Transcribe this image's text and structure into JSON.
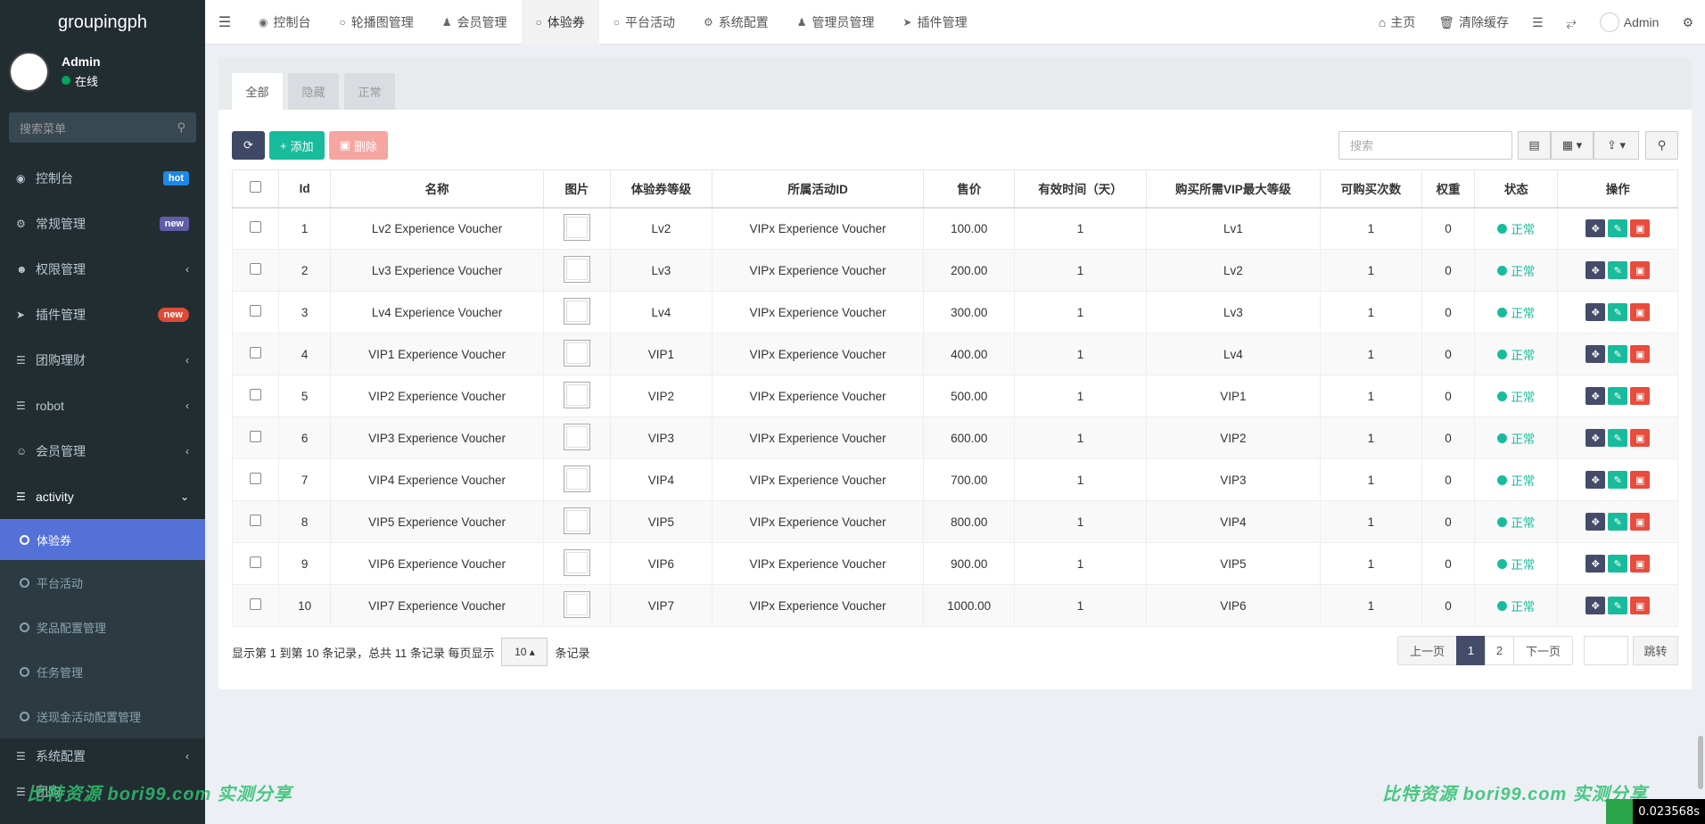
{
  "app": {
    "logo": "groupingph"
  },
  "user": {
    "name": "Admin",
    "status": "在线"
  },
  "sidebar": {
    "search_placeholder": "搜索菜单",
    "items": [
      {
        "label": "控制台",
        "icon": "dashboard-icon",
        "badge": "hot"
      },
      {
        "label": "常规管理",
        "icon": "cogs-icon",
        "badge": "new"
      },
      {
        "label": "权限管理",
        "icon": "group-icon"
      },
      {
        "label": "插件管理",
        "icon": "rocket-icon",
        "badge": "new"
      },
      {
        "label": "团购理财",
        "icon": "list-icon"
      },
      {
        "label": "robot",
        "icon": "list-icon"
      },
      {
        "label": "会员管理",
        "icon": "user-circle-icon"
      },
      {
        "label": "activity",
        "icon": "list-icon"
      }
    ],
    "subitems": [
      {
        "label": "体验券"
      },
      {
        "label": "平台活动"
      },
      {
        "label": "奖品配置管理"
      },
      {
        "label": "任务管理"
      },
      {
        "label": "送现金活动配置管理"
      }
    ],
    "bottom_items": [
      {
        "label": "系统配置"
      },
      {
        "label": "团购"
      }
    ]
  },
  "topnav": {
    "tabs": [
      {
        "label": "控制台",
        "icon": "dashboard-icon"
      },
      {
        "label": "轮播图管理",
        "icon": "circle-icon"
      },
      {
        "label": "会员管理",
        "icon": "user-icon"
      },
      {
        "label": "体验券",
        "icon": "circle-icon"
      },
      {
        "label": "平台活动",
        "icon": "circle-icon"
      },
      {
        "label": "系统配置",
        "icon": "cog-icon"
      },
      {
        "label": "管理员管理",
        "icon": "user-icon"
      },
      {
        "label": "插件管理",
        "icon": "rocket-icon"
      }
    ],
    "right": {
      "home": "主页",
      "clear_cache": "清除缓存",
      "admin": "Admin"
    }
  },
  "filter_tabs": [
    "全部",
    "隐藏",
    "正常"
  ],
  "toolbar": {
    "add": "添加",
    "delete": "删除",
    "search_placeholder": "搜索"
  },
  "table": {
    "headers": [
      "Id",
      "名称",
      "图片",
      "体验券等级",
      "所属活动ID",
      "售价",
      "有效时间（天）",
      "购买所需VIP最大等级",
      "可购买次数",
      "权重",
      "状态",
      "操作"
    ],
    "rows": [
      {
        "id": "1",
        "name": "Lv2 Experience Voucher",
        "level": "Lv2",
        "activity": "VIPx Experience Voucher",
        "price": "100.00",
        "days": "1",
        "vip": "Lv1",
        "times": "1",
        "weight": "0",
        "status": "正常"
      },
      {
        "id": "2",
        "name": "Lv3 Experience Voucher",
        "level": "Lv3",
        "activity": "VIPx Experience Voucher",
        "price": "200.00",
        "days": "1",
        "vip": "Lv2",
        "times": "1",
        "weight": "0",
        "status": "正常"
      },
      {
        "id": "3",
        "name": "Lv4 Experience Voucher",
        "level": "Lv4",
        "activity": "VIPx Experience Voucher",
        "price": "300.00",
        "days": "1",
        "vip": "Lv3",
        "times": "1",
        "weight": "0",
        "status": "正常"
      },
      {
        "id": "4",
        "name": "VIP1 Experience Voucher",
        "level": "VIP1",
        "activity": "VIPx Experience Voucher",
        "price": "400.00",
        "days": "1",
        "vip": "Lv4",
        "times": "1",
        "weight": "0",
        "status": "正常"
      },
      {
        "id": "5",
        "name": "VIP2 Experience Voucher",
        "level": "VIP2",
        "activity": "VIPx Experience Voucher",
        "price": "500.00",
        "days": "1",
        "vip": "VIP1",
        "times": "1",
        "weight": "0",
        "status": "正常"
      },
      {
        "id": "6",
        "name": "VIP3 Experience Voucher",
        "level": "VIP3",
        "activity": "VIPx Experience Voucher",
        "price": "600.00",
        "days": "1",
        "vip": "VIP2",
        "times": "1",
        "weight": "0",
        "status": "正常"
      },
      {
        "id": "7",
        "name": "VIP4 Experience Voucher",
        "level": "VIP4",
        "activity": "VIPx Experience Voucher",
        "price": "700.00",
        "days": "1",
        "vip": "VIP3",
        "times": "1",
        "weight": "0",
        "status": "正常"
      },
      {
        "id": "8",
        "name": "VIP5 Experience Voucher",
        "level": "VIP5",
        "activity": "VIPx Experience Voucher",
        "price": "800.00",
        "days": "1",
        "vip": "VIP4",
        "times": "1",
        "weight": "0",
        "status": "正常"
      },
      {
        "id": "9",
        "name": "VIP6 Experience Voucher",
        "level": "VIP6",
        "activity": "VIPx Experience Voucher",
        "price": "900.00",
        "days": "1",
        "vip": "VIP5",
        "times": "1",
        "weight": "0",
        "status": "正常"
      },
      {
        "id": "10",
        "name": "VIP7 Experience Voucher",
        "level": "VIP7",
        "activity": "VIPx Experience Voucher",
        "price": "1000.00",
        "days": "1",
        "vip": "VIP6",
        "times": "1",
        "weight": "0",
        "status": "正常"
      }
    ]
  },
  "pagination": {
    "info_prefix": "显示第 1 到第 10 条记录，总共 11 条记录 每页显示",
    "page_size": "10",
    "info_suffix": "条记录",
    "prev": "上一页",
    "pages": [
      "1",
      "2"
    ],
    "next": "下一页",
    "jump": "跳转"
  },
  "watermark": "比特资源  bori99.com  实测分享",
  "render_time": "0.023568s",
  "colors": {
    "sidebar_bg": "#222d32",
    "active_sub": "#5471d8",
    "green": "#18bc9c",
    "dark": "#444c69",
    "danger": "#e74c3c"
  }
}
